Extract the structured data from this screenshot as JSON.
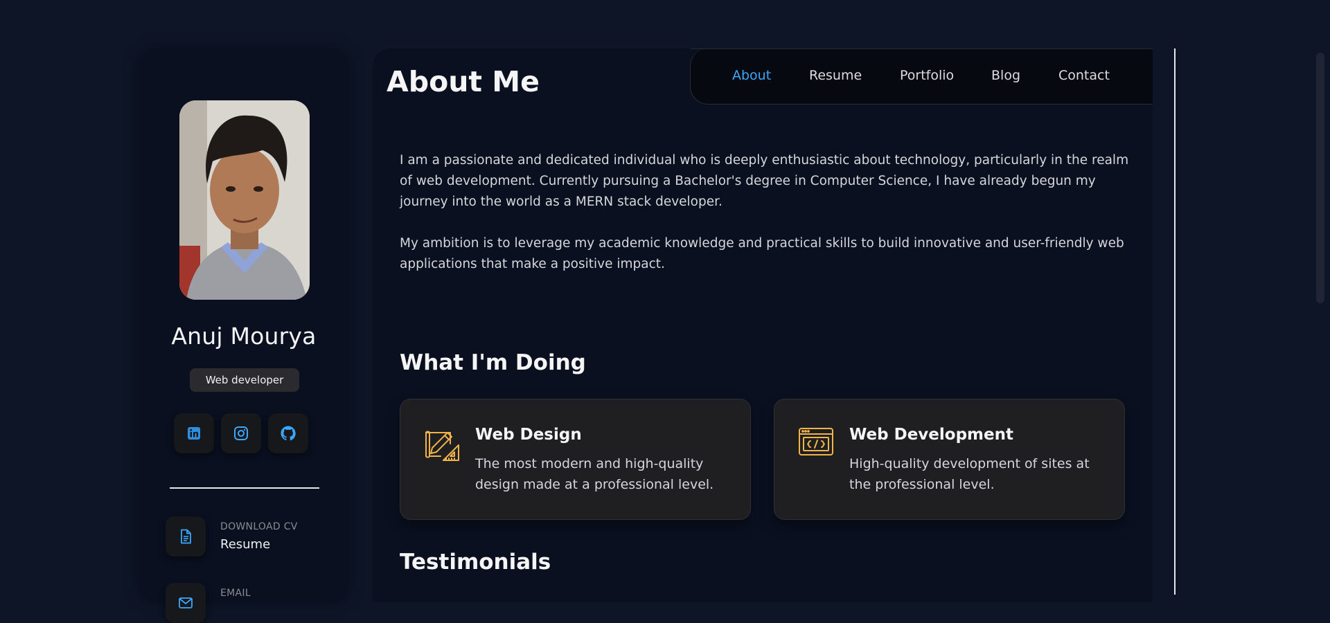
{
  "profile": {
    "name": "Anuj Mourya",
    "title": "Web developer",
    "socials": [
      {
        "name": "linkedin-icon"
      },
      {
        "name": "instagram-icon"
      },
      {
        "name": "github-icon"
      }
    ],
    "contacts": [
      {
        "label": "DOWNLOAD CV",
        "value": "Resume",
        "icon": "document-icon"
      },
      {
        "label": "EMAIL",
        "value": "",
        "icon": "mail-icon"
      }
    ]
  },
  "nav": {
    "items": [
      "About",
      "Resume",
      "Portfolio",
      "Blog",
      "Contact"
    ],
    "active": "About"
  },
  "about": {
    "title": "About Me",
    "paragraphs": [
      "I am a passionate and dedicated individual who is deeply enthusiastic about technology, particularly in the realm of web development. Currently pursuing a Bachelor's degree in Computer Science, I have already begun my journey into the world as a MERN stack developer.",
      "My ambition is to leverage my academic knowledge and practical skills to build innovative and user-friendly web applications that make a positive impact."
    ]
  },
  "services": {
    "heading": "What I'm Doing",
    "items": [
      {
        "title": "Web Design",
        "text": "The most modern and high-quality design made at a professional level.",
        "icon": "design-icon"
      },
      {
        "title": "Web Development",
        "text": "High-quality development of sites at the professional level.",
        "icon": "code-window-icon"
      }
    ]
  },
  "testimonials": {
    "heading": "Testimonials"
  },
  "colors": {
    "background": "#0d1527",
    "panel": "#0a1020",
    "accent_blue": "#3aa8ff",
    "accent_gold": "#f3b54a",
    "card": "#1f1f22"
  }
}
